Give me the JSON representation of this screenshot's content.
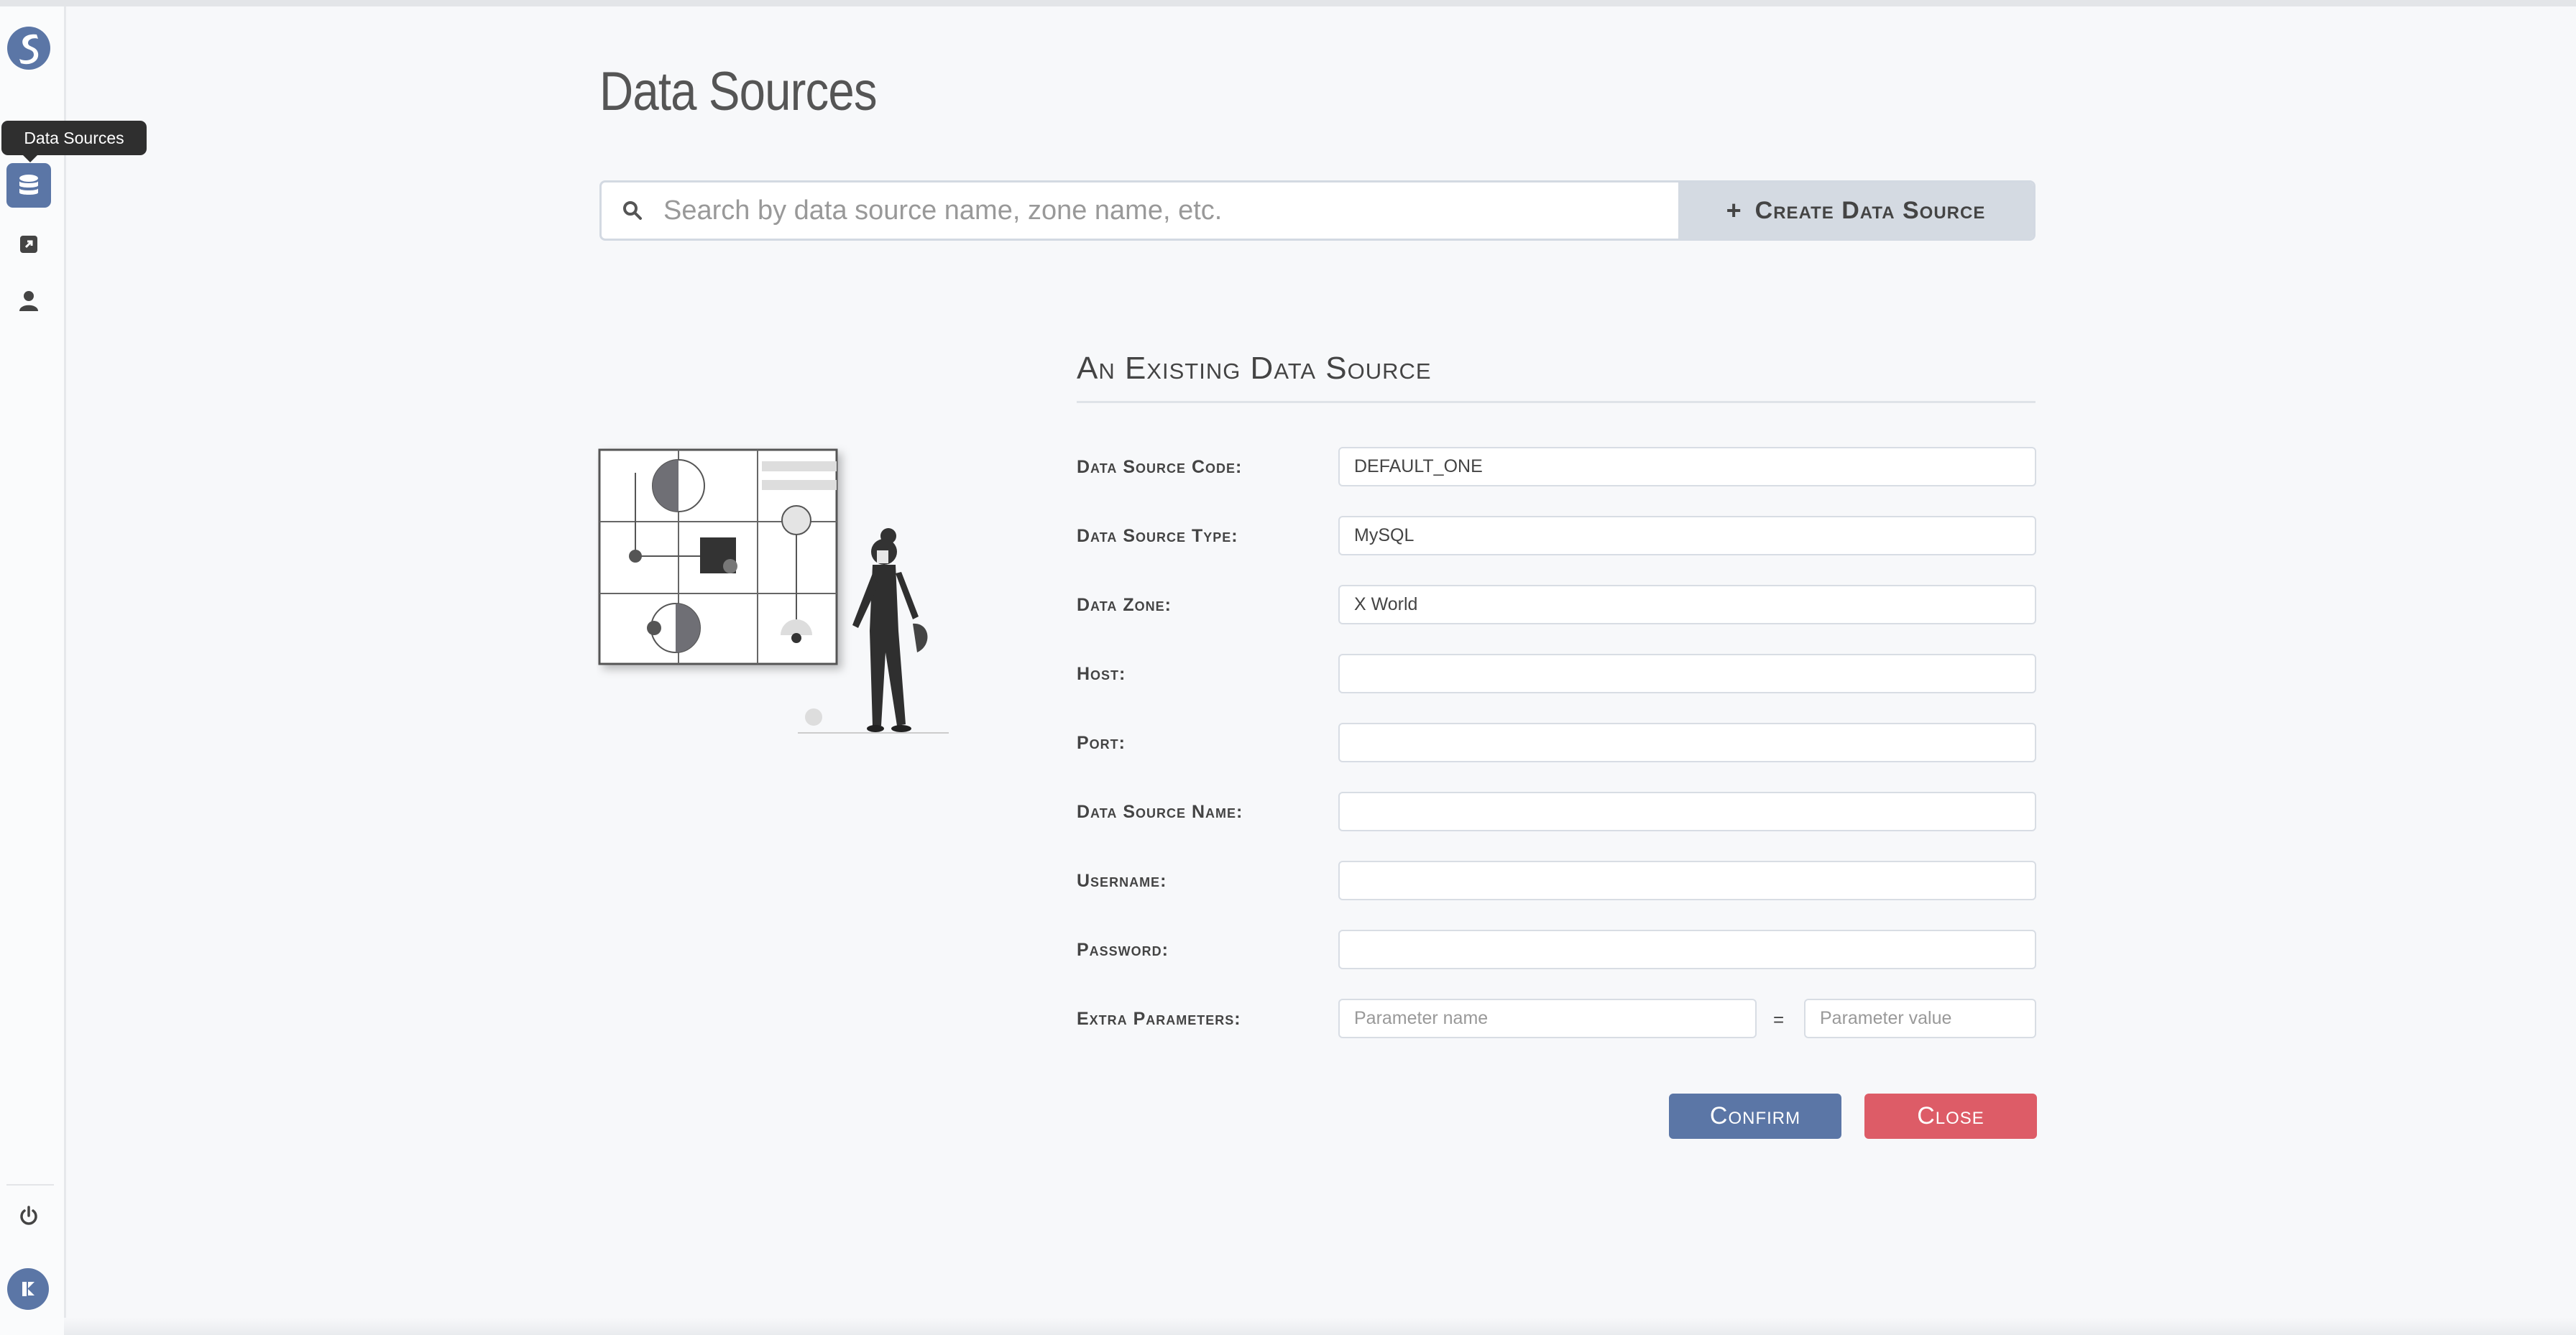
{
  "sidebar": {
    "tooltip": "Data Sources",
    "items": [
      {
        "icon": "database-icon",
        "active": true
      },
      {
        "icon": "external-link-icon",
        "active": false
      },
      {
        "icon": "user-icon",
        "active": false
      }
    ],
    "power_icon": "power-icon",
    "avatar_icon": "user-avatar-icon"
  },
  "page": {
    "title": "Data Sources"
  },
  "search": {
    "placeholder": "Search by data source name, zone name, etc.",
    "create_label": "Create Data Source"
  },
  "form": {
    "title": "An Existing Data Source",
    "fields": [
      {
        "label": "Data Source Code:",
        "value": "DEFAULT_ONE"
      },
      {
        "label": "Data Source Type:",
        "value": "MySQL"
      },
      {
        "label": "Data Zone:",
        "value": "X World"
      },
      {
        "label": "Host:",
        "value": ""
      },
      {
        "label": "Port:",
        "value": ""
      },
      {
        "label": "Data Source Name:",
        "value": ""
      },
      {
        "label": "Username:",
        "value": ""
      },
      {
        "label": "Password:",
        "value": ""
      }
    ],
    "extra": {
      "label": "Extra Parameters:",
      "name_placeholder": "Parameter name",
      "value_placeholder": "Parameter value",
      "separator": "="
    },
    "confirm_label": "Confirm",
    "close_label": "Close"
  },
  "colors": {
    "accent": "#5b76a6",
    "danger": "#dd5c67"
  }
}
